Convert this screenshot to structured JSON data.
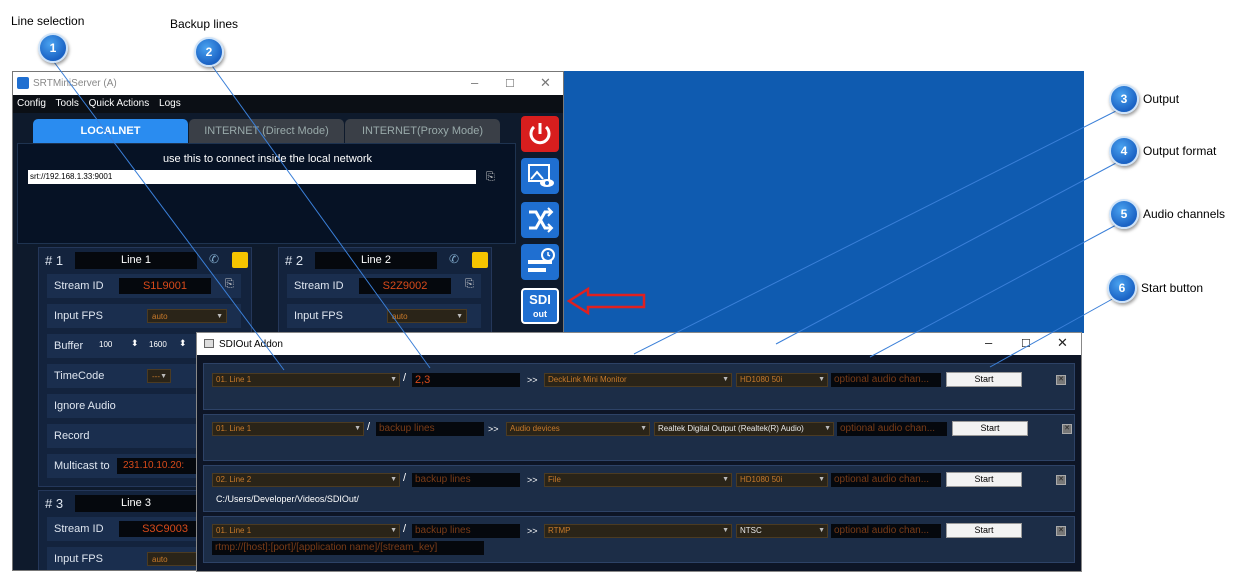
{
  "callouts": [
    {
      "n": "1",
      "label": "Line selection"
    },
    {
      "n": "2",
      "label": "Backup lines"
    },
    {
      "n": "3",
      "label": "Output"
    },
    {
      "n": "4",
      "label": "Output format"
    },
    {
      "n": "5",
      "label": "Audio channels"
    },
    {
      "n": "6",
      "label": "Start button"
    }
  ],
  "window": {
    "title": "SRTMiniServer (A)",
    "menu": [
      "Config",
      "Tools",
      "Quick Actions",
      "Logs"
    ],
    "tabs": [
      "LOCALNET",
      "INTERNET (Direct Mode)",
      "INTERNET(Proxy Mode)"
    ],
    "info": "use this to connect inside the local network",
    "url": "srt://192.168.1.33:9001"
  },
  "lines": [
    {
      "num": "# 1",
      "name": "Line 1",
      "stream_id": "S1L9001",
      "fps": "auto",
      "buffer_a": "100",
      "buffer_b": "1600",
      "timecode": "---",
      "multicast": "231.10.10.20:"
    },
    {
      "num": "# 2",
      "name": "Line 2",
      "stream_id": "S2Z9002",
      "fps": "auto"
    },
    {
      "num": "# 3",
      "name": "Line 3",
      "stream_id": "S3C9003",
      "fps": "auto"
    }
  ],
  "row_labels": {
    "stream_id": "Stream ID",
    "input_fps": "Input FPS",
    "buffer": "Buffer",
    "timecode": "TimeCode",
    "ignore_audio": "Ignore Audio",
    "record": "Record",
    "multicast": "Multicast to"
  },
  "sdi_button": {
    "top": "SDI",
    "bottom": "out"
  },
  "addon": {
    "title": "SDIOut Addon",
    "rows": [
      {
        "line": "01. Line 1",
        "backup": "2,3",
        "output": "DeckLink Mini Monitor",
        "format": "HD1080  50i",
        "audio": "optional audio chan...",
        "start": "Start",
        "extra": ""
      },
      {
        "line": "01. Line 1",
        "backup": "backup lines",
        "output": "Audio devices",
        "format": "Realtek Digital Output (Realtek(R) Audio)",
        "audio": "optional audio chan...",
        "start": "Start",
        "extra": ""
      },
      {
        "line": "02. Line 2",
        "backup": "backup lines",
        "output": "File",
        "format": "HD1080  50i",
        "audio": "optional audio chan...",
        "start": "Start",
        "extra": "C:/Users/Developer/Videos/SDIOut/"
      },
      {
        "line": "01. Line 1",
        "backup": "backup lines",
        "output": "RTMP",
        "format": "NTSC",
        "audio": "optional audio chan...",
        "start": "Start",
        "extra": "rtmp://[host]:[port]/[application name]/[stream_key]"
      }
    ],
    "arrow": ">>"
  },
  "colors": {
    "accent": "#1f6fd1",
    "desktop": "#0f5bb0",
    "value_text": "#d84a1a"
  }
}
